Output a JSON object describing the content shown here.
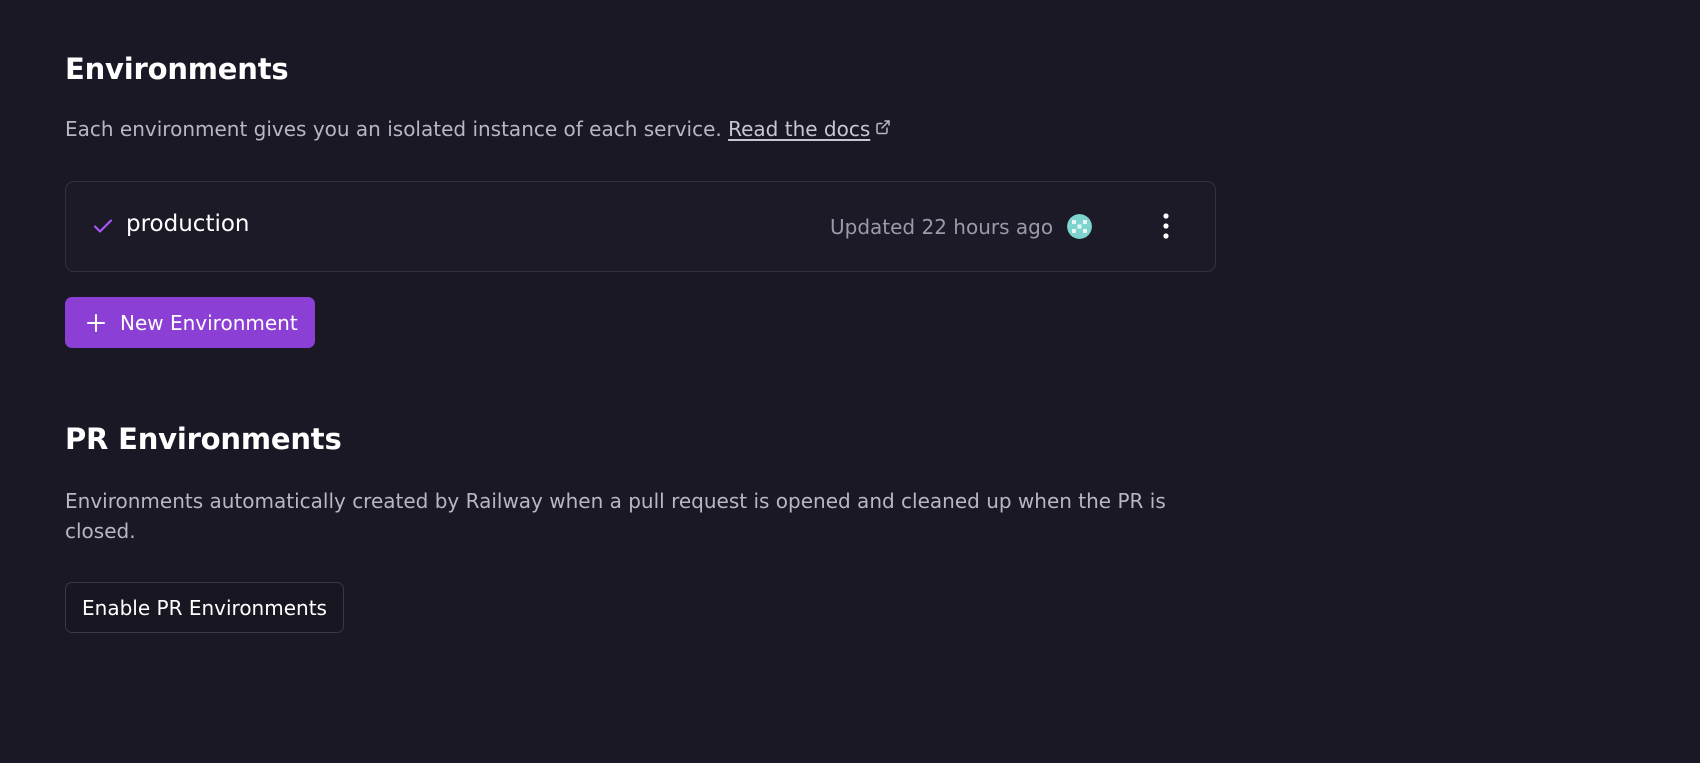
{
  "environments": {
    "title": "Environments",
    "description": "Each environment gives you an isolated instance of each service.",
    "docs_link_label": "Read the docs",
    "items": [
      {
        "name": "production",
        "updated": "Updated 22 hours ago",
        "status_icon": "check-icon",
        "avatar_icon": "avatar"
      }
    ],
    "new_button_label": "New Environment"
  },
  "pr_environments": {
    "title": "PR Environments",
    "description": "Environments automatically created by Railway when a pull request is opened and cleaned up when the PR is closed.",
    "enable_button_label": "Enable PR Environments"
  },
  "colors": {
    "background": "#1a1825",
    "accent": "#8b3fd4",
    "check": "#a855f7",
    "avatar": "#7fd3cf"
  }
}
